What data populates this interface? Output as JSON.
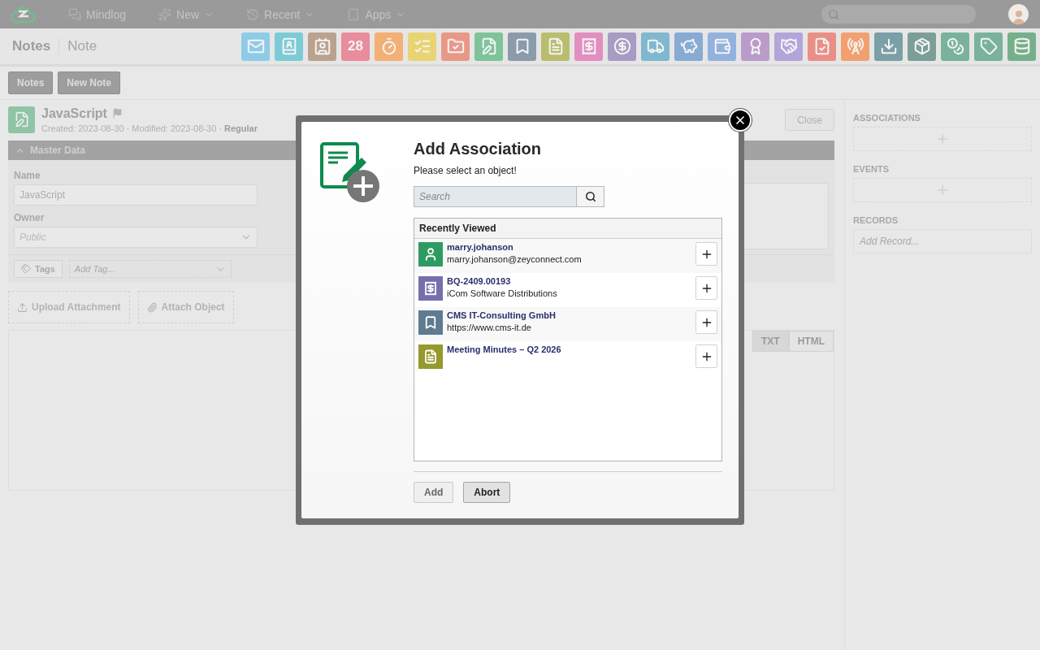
{
  "top_bar": {
    "nav": [
      {
        "label": "Mindlog",
        "kind": "chat",
        "dropdown": false
      },
      {
        "label": "New",
        "kind": "sparkle",
        "dropdown": true
      },
      {
        "label": "Recent",
        "kind": "history",
        "dropdown": true
      },
      {
        "label": "Apps",
        "kind": "tablet",
        "dropdown": true
      }
    ]
  },
  "breadcrumb": {
    "module": "Notes",
    "page": "Note"
  },
  "app_tiles": [
    {
      "kind": "mail",
      "color": "#8ecbe8"
    },
    {
      "kind": "contacts",
      "color": "#7ccbd6"
    },
    {
      "kind": "address-book",
      "color": "#b9a38f"
    },
    {
      "kind": "calendar",
      "color": "#e98c9c",
      "text": "28"
    },
    {
      "kind": "timer",
      "color": "#f2b074"
    },
    {
      "kind": "tasks",
      "color": "#e9d474"
    },
    {
      "kind": "folder",
      "color": "#e99888"
    },
    {
      "kind": "note",
      "color": "#7ec39a"
    },
    {
      "kind": "bookmark",
      "color": "#8a9bab"
    },
    {
      "kind": "document",
      "color": "#b9bd6d"
    },
    {
      "kind": "receipt",
      "color": "#e28ec0"
    },
    {
      "kind": "dollar",
      "color": "#a69cc4"
    },
    {
      "kind": "truck",
      "color": "#7fb8cf"
    },
    {
      "kind": "piggy-bank",
      "color": "#87abd3"
    },
    {
      "kind": "wallet",
      "color": "#93b1dd"
    },
    {
      "kind": "award",
      "color": "#ba9bca"
    },
    {
      "kind": "handshake",
      "color": "#b2a5d9"
    },
    {
      "kind": "file-check",
      "color": "#ea8f88"
    },
    {
      "kind": "radio-tower",
      "color": "#f2a070"
    },
    {
      "kind": "download",
      "color": "#7b9fa6"
    },
    {
      "kind": "package",
      "color": "#7b9f97"
    },
    {
      "kind": "coins",
      "color": "#79b39b"
    },
    {
      "kind": "tag",
      "color": "#79b39b"
    },
    {
      "kind": "database",
      "color": "#76b08b"
    }
  ],
  "toolbar": [
    "Notes",
    "New Note"
  ],
  "record": {
    "title": "JavaScript",
    "meta": "Created: 2023-08-30 · Modified: 2023-08-30 · **Regular**",
    "close": "Close"
  },
  "master_data": {
    "title": "Master Data",
    "expanded": true,
    "name_label": "Name",
    "name_value": "JavaScript",
    "owner_label": "Owner",
    "owner_placeholder": "Public"
  },
  "tags": {
    "label": "Tags",
    "placeholder": "Add Tag..."
  },
  "attachments": [
    "Upload Attachment",
    "Attach Object"
  ],
  "editor_modes": [
    {
      "label": "TXT",
      "selected": true
    },
    {
      "label": "HTML",
      "selected": false
    }
  ],
  "sidebar": {
    "associations": "ASSOCIATIONS",
    "events": "EVENTS",
    "records": "RECORDS",
    "records_placeholder": "Add Record..."
  },
  "dialog": {
    "title": "Add Association",
    "subtitle": "Please select an object!",
    "search_placeholder": "Search",
    "list_title": "Recently Viewed",
    "items": [
      {
        "kind": "person",
        "color": "#2e9c62",
        "title": "marry.johanson",
        "subtitle": "marry.johanson@zeyconnect.com"
      },
      {
        "kind": "quote",
        "color": "#7470ad",
        "title": "BQ-2409.00193",
        "subtitle": "iCom Software Distributions"
      },
      {
        "kind": "bookmark",
        "color": "#5e7b92",
        "title": "CMS IT-Consulting GmbH",
        "subtitle": "https://www.cms-it.de"
      },
      {
        "kind": "minutes",
        "color": "#96992c",
        "title": "Meeting Minutes – Q2 2026"
      }
    ],
    "buttons": [
      {
        "label": "Add",
        "disabled": true
      },
      {
        "label": "Abort",
        "disabled": false
      }
    ]
  }
}
